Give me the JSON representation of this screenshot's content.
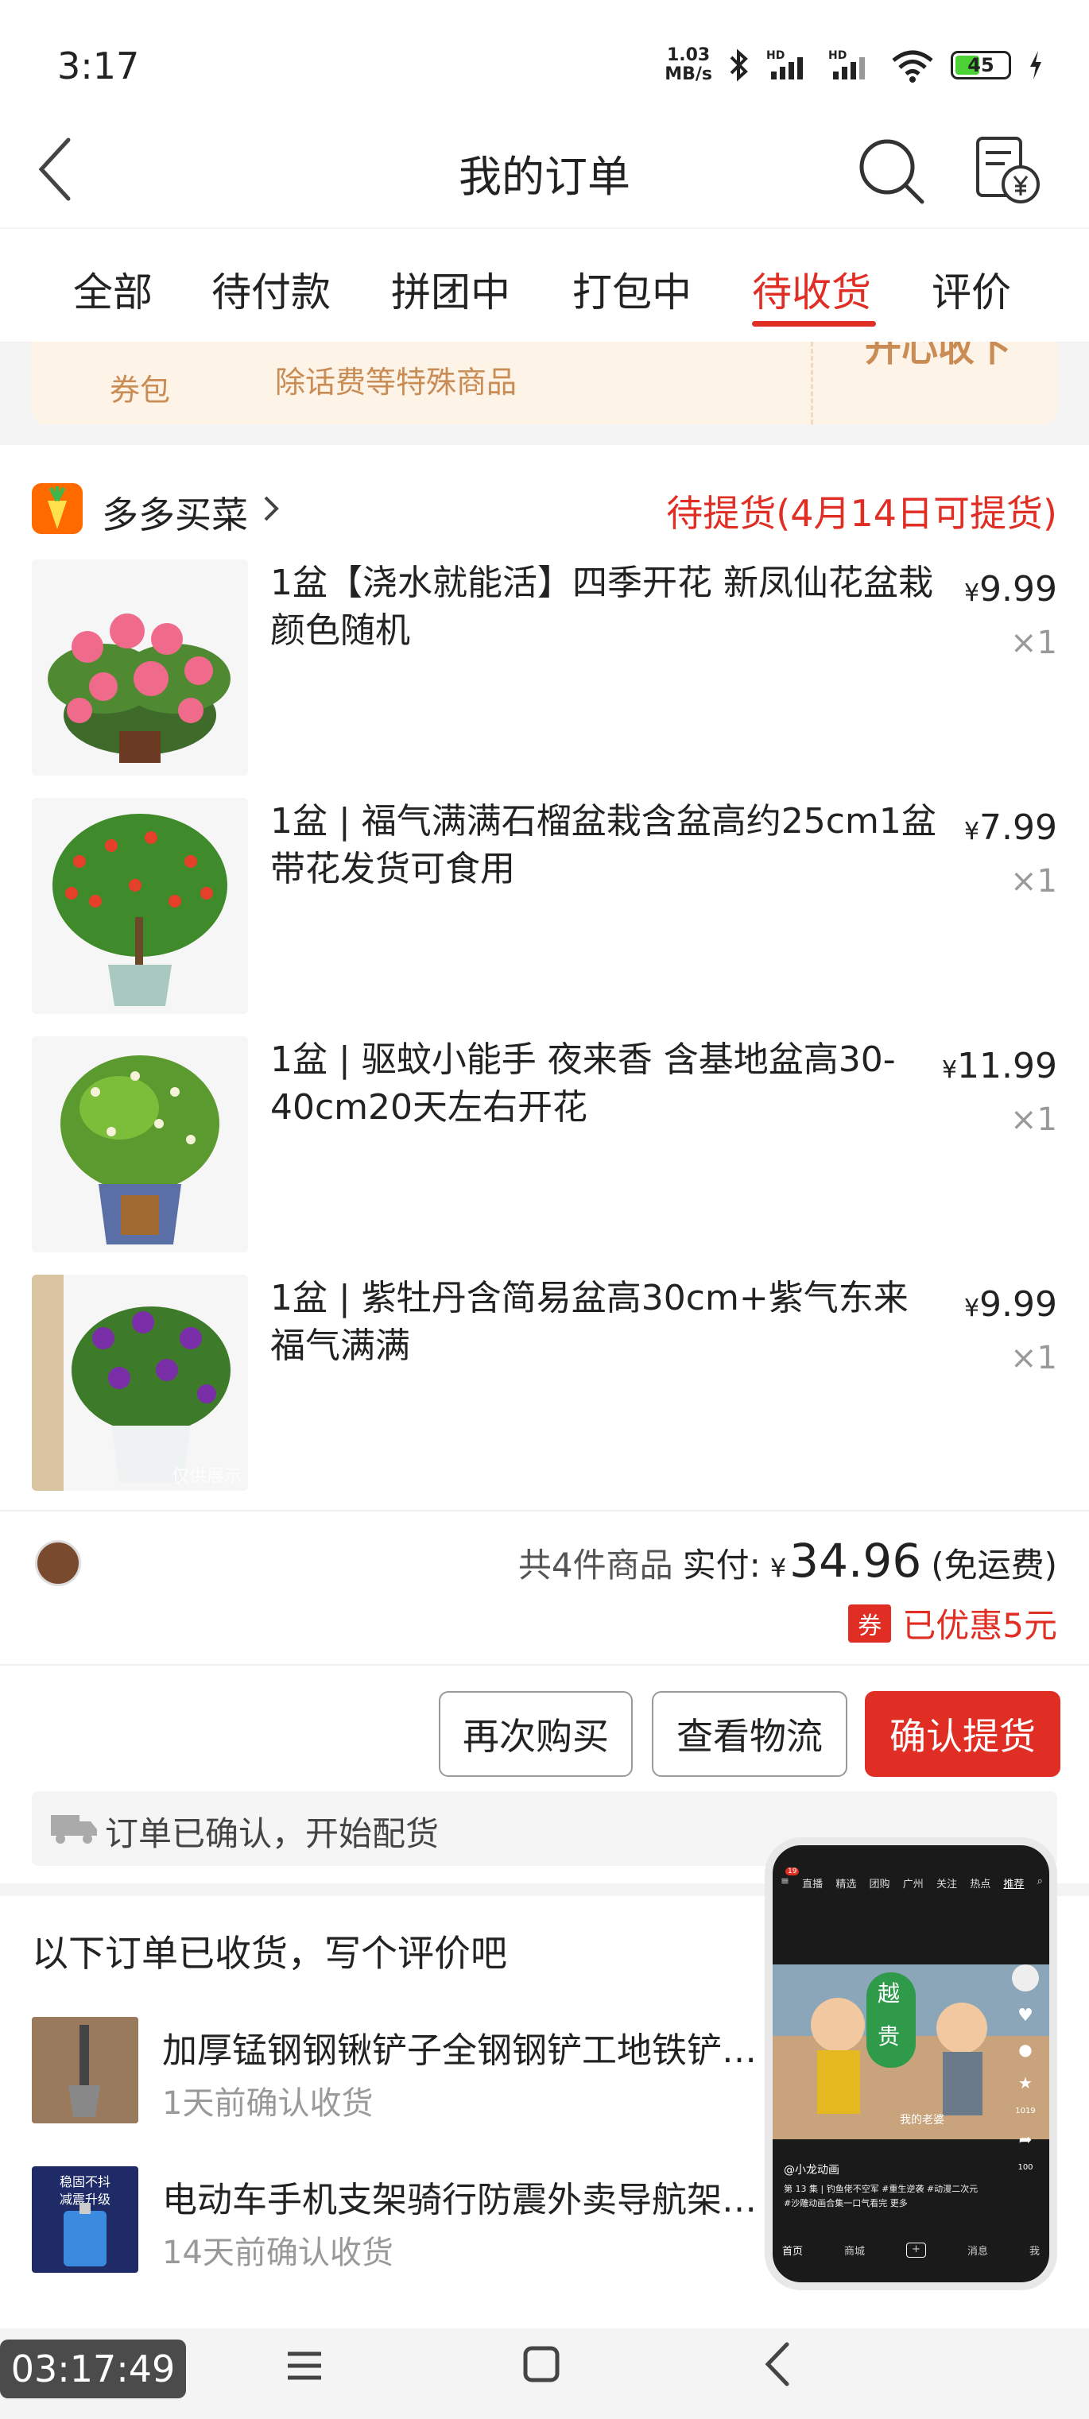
{
  "status_bar": {
    "time": "3:17",
    "net_speed_value": "1.03",
    "net_speed_unit": "MB/s",
    "battery": "45",
    "sim1_label": "HD",
    "sim2_label": "HD"
  },
  "header": {
    "title": "我的订单"
  },
  "tabs": [
    {
      "label": "全部",
      "active": false
    },
    {
      "label": "待付款",
      "active": false
    },
    {
      "label": "拼团中",
      "active": false
    },
    {
      "label": "打包中",
      "active": false
    },
    {
      "label": "待收货",
      "active": true
    },
    {
      "label": "评价",
      "active": false
    }
  ],
  "coupon_strip": {
    "left_label": "券包",
    "middle_text": "除话费等特殊商品",
    "right_text": "开心收下"
  },
  "order": {
    "store_name": "多多买菜",
    "status": "待提货(4月14日可提货)",
    "items": [
      {
        "title": "1盆【浇水就能活】四季开花 新凤仙花盆栽 颜色随机",
        "price_symbol": "¥",
        "price": "9.99",
        "qty": "×1",
        "img": "pink-flower"
      },
      {
        "title": "1盆 | 福气满满石榴盆栽含盆高约25cm1盆带花发货可食用",
        "price_symbol": "¥",
        "price": "7.99",
        "qty": "×1",
        "img": "pomegranate"
      },
      {
        "title": "1盆 | 驱蚊小能手 夜来香 含基地盆高30-40cm20天左右开花",
        "price_symbol": "¥",
        "price": "11.99",
        "qty": "×1",
        "img": "night-jasmine"
      },
      {
        "title": "1盆 | 紫牡丹含简易盆高30cm+紫气东来福气满满",
        "price_symbol": "¥",
        "price": "9.99",
        "qty": "×1",
        "img": "purple-peony"
      }
    ],
    "img_watermark": "仅供展示",
    "summary": {
      "count_text": "共4件商品",
      "paid_label": "实付:",
      "currency": "¥",
      "total": "34.96",
      "shipping_note": "(免运费)",
      "coupon_badge": "券",
      "discount_text": "已优惠5元"
    },
    "actions": {
      "rebuy": "再次购买",
      "logistics": "查看物流",
      "confirm": "确认提货"
    },
    "logistics_status": "订单已确认，开始配货"
  },
  "reviews": {
    "heading": "以下订单已收货，写个评价吧",
    "items": [
      {
        "title": "加厚锰钢钢锹铲子全钢钢铲工地铁铲…",
        "sub": "1天前确认收货"
      },
      {
        "title": "电动车手机支架骑行防震外卖导航架…",
        "sub": "14天前确认收货",
        "thumb_text_1": "稳固不抖",
        "thumb_text_2": "减震升级"
      }
    ]
  },
  "floating_video": {
    "tabs": [
      "直播",
      "精选",
      "团购",
      "广州",
      "关注",
      "热点",
      "推荐"
    ],
    "badge_count": "19",
    "author": "@小龙动画",
    "caption": "第 13 集 | 钓鱼佬不空军 #重生逆袭 #动漫二次元",
    "caption2": "#沙雕动画合集一口气看完  更多",
    "bottom_nav": [
      "首页",
      "商城",
      "+",
      "消息",
      "我"
    ],
    "side_counts": [
      "1019",
      "100"
    ],
    "sign_text": "越",
    "sign_text2": "贵",
    "caption_small": "我的老婆"
  },
  "bottom_bar": {
    "clock": "03:17:49"
  }
}
